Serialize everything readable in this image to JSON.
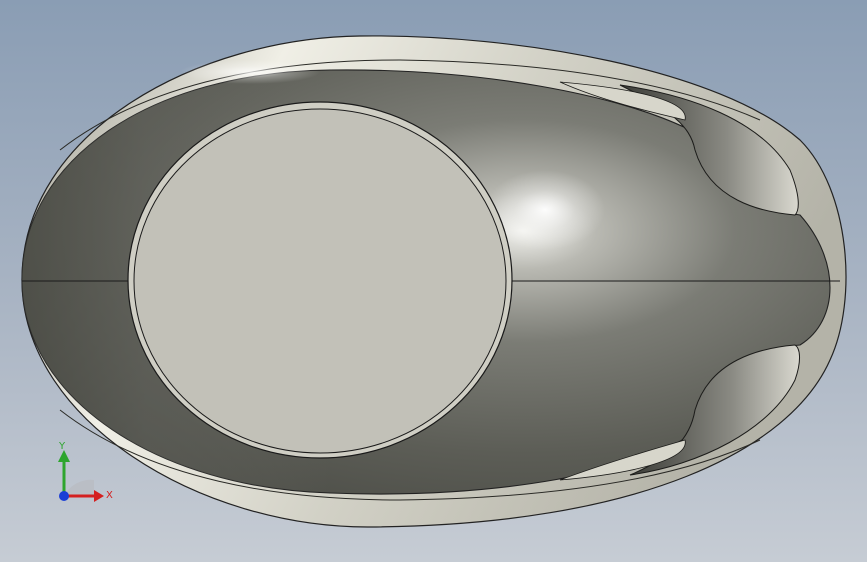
{
  "viewport": {
    "background_top": "#8a9db4",
    "background_bottom": "#c4cad3"
  },
  "model": {
    "shell_color": "#6e6f69",
    "rim_color": "#c8c7bc",
    "face_color": "#c2c1b8",
    "edge_color": "#1a1a1a"
  },
  "triad": {
    "x_label": "X",
    "y_label": "Y",
    "x_color": "#d42020",
    "y_color": "#2ea52e",
    "z_color": "#1b3fd6"
  }
}
